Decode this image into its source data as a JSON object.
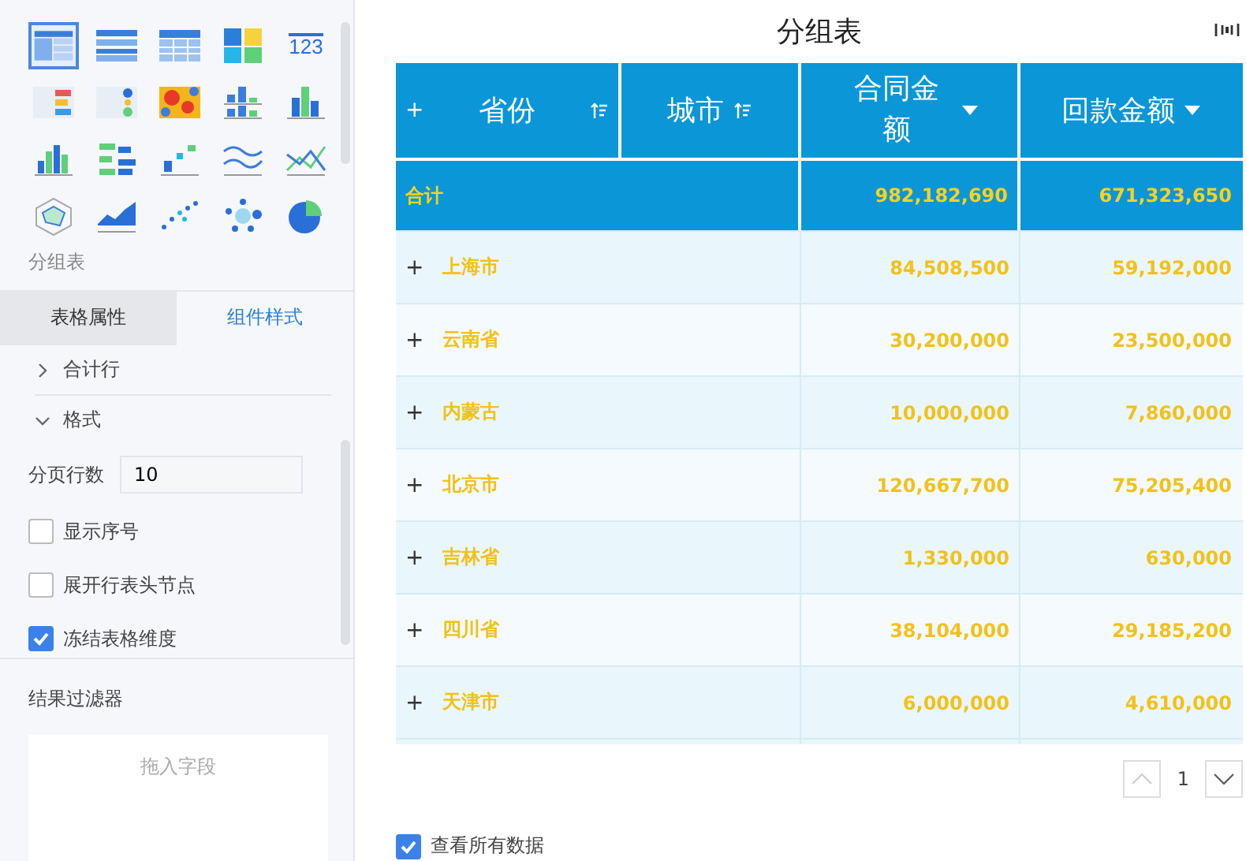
{
  "chart_types": [
    {
      "kind": "table",
      "selected": true
    },
    {
      "kind": "table-striped",
      "selected": false
    },
    {
      "kind": "table-grid",
      "selected": false
    },
    {
      "kind": "tiles",
      "selected": false
    },
    {
      "kind": "number",
      "label": "123",
      "selected": false
    },
    {
      "kind": "kpi-list",
      "selected": false
    },
    {
      "kind": "kpi-dots",
      "selected": false
    },
    {
      "kind": "heatmap",
      "selected": false
    },
    {
      "kind": "stacked-bar",
      "selected": false
    },
    {
      "kind": "bar-grouped",
      "selected": false
    },
    {
      "kind": "bar",
      "selected": false
    },
    {
      "kind": "bar-horizontal",
      "selected": false
    },
    {
      "kind": "step",
      "selected": false
    },
    {
      "kind": "line-multi",
      "selected": false
    },
    {
      "kind": "line-cross",
      "selected": false
    },
    {
      "kind": "radar",
      "selected": false
    },
    {
      "kind": "area",
      "selected": false
    },
    {
      "kind": "scatter",
      "selected": false
    },
    {
      "kind": "bubble",
      "selected": false
    },
    {
      "kind": "pie",
      "selected": false
    }
  ],
  "chart_type_label": "分组表",
  "tabs": [
    {
      "label": "表格属性",
      "selected": true
    },
    {
      "label": "组件样式",
      "selected": false
    }
  ],
  "sections": [
    {
      "label": "合计行",
      "expanded": false
    },
    {
      "label": "格式",
      "expanded": true
    }
  ],
  "page_rows": {
    "label": "分页行数",
    "value": "10"
  },
  "options": [
    {
      "label": "显示序号",
      "checked": false
    },
    {
      "label": "展开行表头节点",
      "checked": false
    },
    {
      "label": "冻结表格维度",
      "checked": true
    }
  ],
  "filter": {
    "title": "结果过滤器",
    "placeholder": "拖入字段"
  },
  "report": {
    "title": "分组表",
    "columns": [
      {
        "label": "省份",
        "sort": true,
        "expand": "+"
      },
      {
        "label": "城市",
        "sort": true
      },
      {
        "label": "合同金额",
        "dropdown": true
      },
      {
        "label": "回款金额",
        "dropdown": true
      }
    ],
    "total": {
      "label": "合计",
      "values": [
        "982,182,690",
        "671,323,650"
      ]
    },
    "rows": [
      {
        "expand": "+",
        "name": "上海市",
        "values": [
          "84,508,500",
          "59,192,000"
        ]
      },
      {
        "expand": "+",
        "name": "云南省",
        "values": [
          "30,200,000",
          "23,500,000"
        ]
      },
      {
        "expand": "+",
        "name": "内蒙古",
        "values": [
          "10,000,000",
          "7,860,000"
        ]
      },
      {
        "expand": "+",
        "name": "北京市",
        "values": [
          "120,667,700",
          "75,205,400"
        ]
      },
      {
        "expand": "+",
        "name": "吉林省",
        "values": [
          "1,330,000",
          "630,000"
        ]
      },
      {
        "expand": "+",
        "name": "四川省",
        "values": [
          "38,104,000",
          "29,185,200"
        ]
      },
      {
        "expand": "+",
        "name": "天津市",
        "values": [
          "6,000,000",
          "4,610,000"
        ]
      }
    ],
    "page": "1",
    "prev_disabled": true,
    "view_all": {
      "label": "查看所有数据",
      "checked": true
    }
  }
}
